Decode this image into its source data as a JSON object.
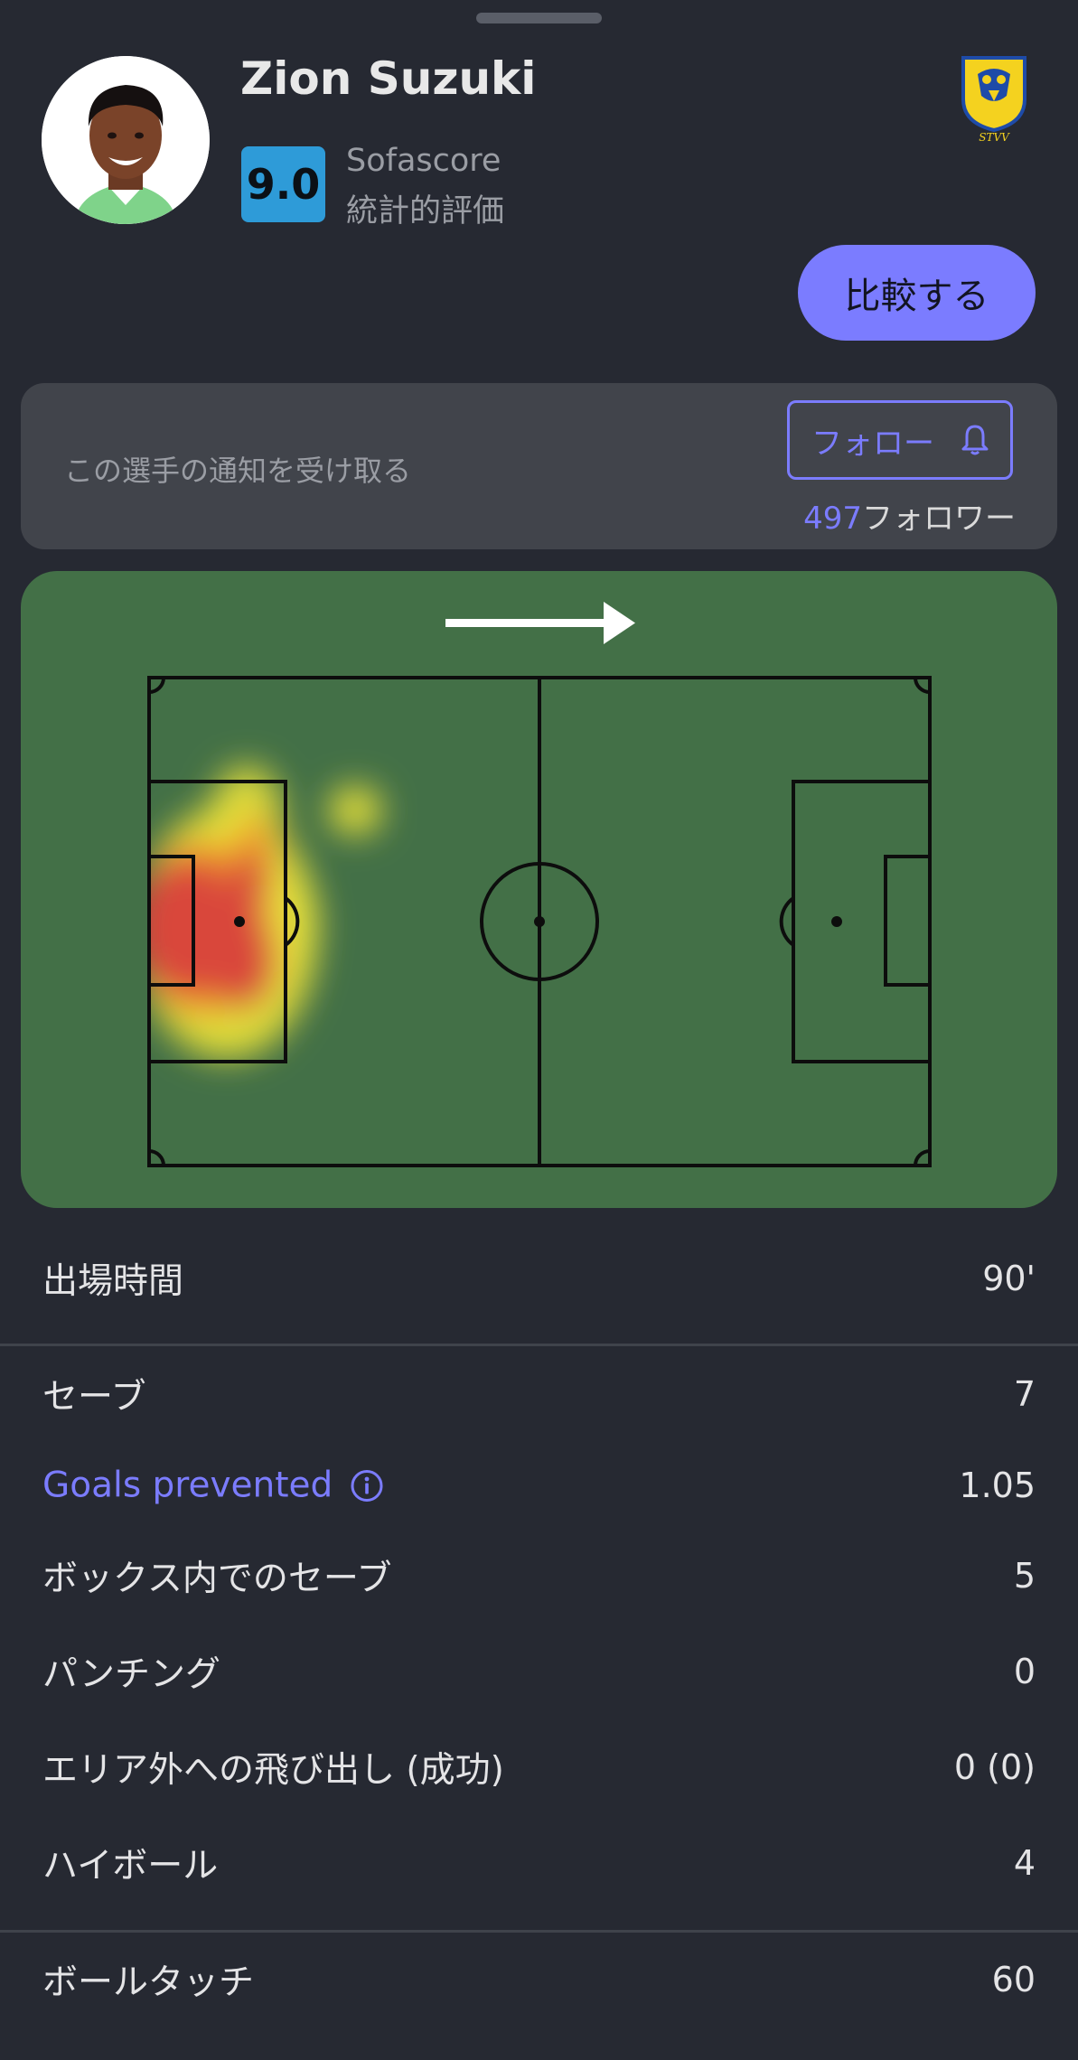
{
  "player": {
    "name": "Zion Suzuki",
    "rating": "9.0",
    "rating_source": "Sofascore",
    "rating_sub": "統計的評価",
    "club_logo_text": "STVV"
  },
  "compare_button": "比較する",
  "notify": {
    "text": "この選手の通知を受け取る",
    "follow_label": "フォロー",
    "follower_count": "497",
    "follower_suffix": "フォロワー"
  },
  "heatmap": {
    "direction": "attack-right-arrow"
  },
  "stats": {
    "minutes": {
      "label": "出場時間",
      "value": "90'"
    },
    "saves": {
      "label": "セーブ",
      "value": "7"
    },
    "goals_prevented": {
      "label": "Goals prevented",
      "value": "1.05"
    },
    "saves_in_box": {
      "label": "ボックス内でのセーブ",
      "value": "5"
    },
    "punches": {
      "label": "パンチング",
      "value": "0"
    },
    "sweeper": {
      "label": "エリア外への飛び出し (成功)",
      "value": "0 (0)"
    },
    "high_claims": {
      "label": "ハイボール",
      "value": "4"
    },
    "touches": {
      "label": "ボールタッチ",
      "value": "60"
    }
  },
  "colors": {
    "background": "#262932",
    "accent": "#7B7CFF",
    "rating_badge": "#2E9BD8",
    "pitch": "#437047",
    "card": "#41444B"
  },
  "icons": [
    "bell-icon",
    "info-icon",
    "arrow-right-icon",
    "club-crest-icon"
  ]
}
